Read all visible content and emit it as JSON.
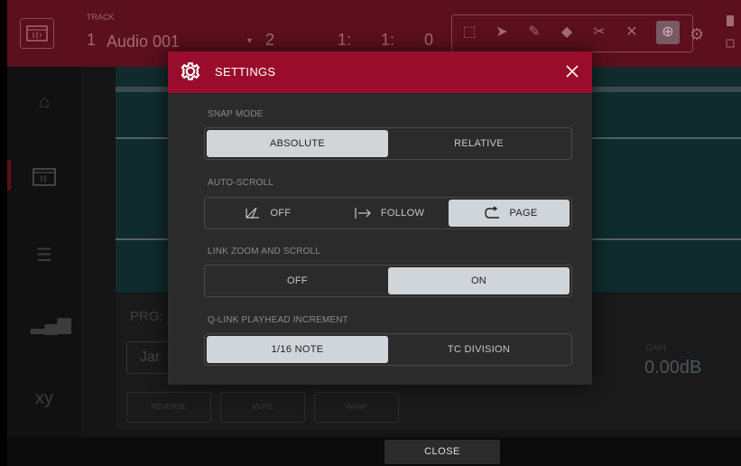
{
  "topbar": {
    "track_label": "TRACK",
    "track_number": "1",
    "track_name": "Audio 001",
    "dropdown_arrow": "▾",
    "value_a": "2",
    "value_b": "1:",
    "value_c": "1:",
    "value_d": "0",
    "tools": [
      "select-box-icon",
      "pointer-icon",
      "pencil-icon",
      "eraser-icon",
      "scissors-icon",
      "mute-icon",
      "zoom-icon"
    ]
  },
  "main": {
    "program_label": "PRG:",
    "program_name": "Jar",
    "gain_label": "GAIN",
    "gain_value": "0.00dB",
    "buttons": [
      "REVERSE",
      "MUTE",
      "WARP"
    ]
  },
  "dialog": {
    "title": "SETTINGS",
    "sections": {
      "snap_mode": {
        "label": "SNAP MODE",
        "options": [
          "ABSOLUTE",
          "RELATIVE"
        ],
        "selected": "ABSOLUTE"
      },
      "auto_scroll": {
        "label": "AUTO-SCROLL",
        "options": [
          "OFF",
          "FOLLOW",
          "PAGE"
        ],
        "selected": "PAGE"
      },
      "link_zoom": {
        "label": "LINK ZOOM AND SCROLL",
        "options": [
          "OFF",
          "ON"
        ],
        "selected": "ON"
      },
      "qlink": {
        "label": "Q-LINK PLAYHEAD INCREMENT",
        "options": [
          "1/16 NOTE",
          "TC DIVISION"
        ],
        "selected": "1/16 NOTE"
      }
    }
  },
  "footer": {
    "close_label": "CLOSE"
  },
  "colors": {
    "header_red": "#9a0c2c",
    "selected_option": "#cfd5d9",
    "dialog_bg": "#2b2b2b"
  }
}
